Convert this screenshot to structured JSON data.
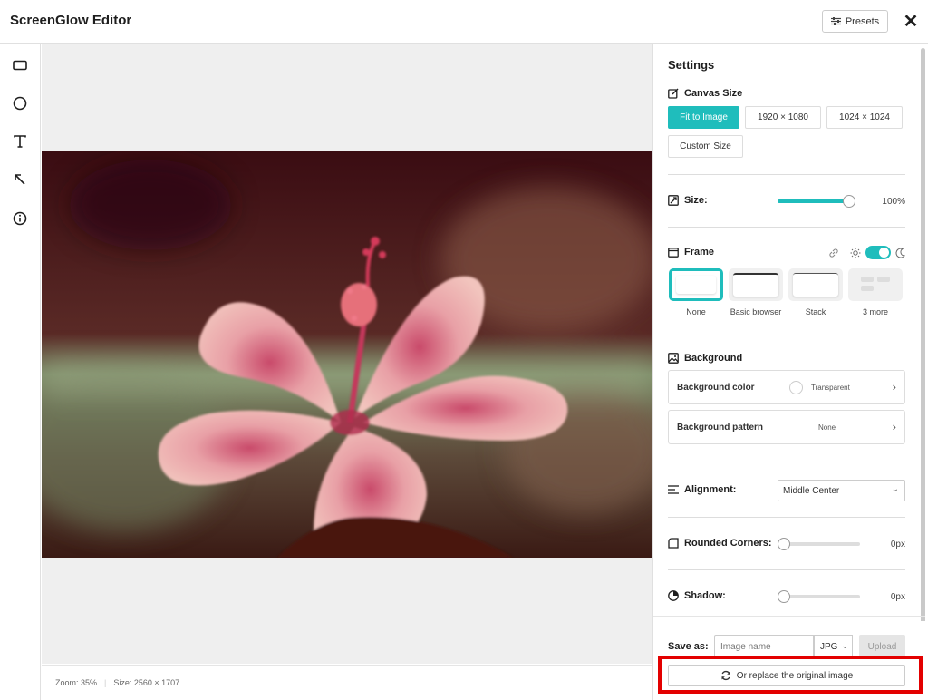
{
  "app": {
    "title": "ScreenGlow Editor",
    "presets_label": "Presets",
    "close_glyph": "✕"
  },
  "toolbar": {
    "tools": [
      "rectangle-icon",
      "circle-icon",
      "text-icon",
      "arrow-icon",
      "info-icon"
    ]
  },
  "status": {
    "zoom": "Zoom: 35%",
    "separator": "|",
    "size": "Size: 2560 × 1707"
  },
  "panel": {
    "title": "Settings",
    "canvas_size": {
      "label": "Canvas Size",
      "options": [
        "Fit to Image",
        "1920 × 1080",
        "1024 × 1024",
        "Custom Size"
      ],
      "selected": "Fit to Image"
    },
    "size": {
      "label": "Size:",
      "value": "100%",
      "level": 1.0
    },
    "frame": {
      "label": "Frame",
      "dark_mode": true,
      "options": [
        "None",
        "Basic browser",
        "Stack",
        "3 more"
      ],
      "selected": "None"
    },
    "background": {
      "label": "Background",
      "color_label": "Background color",
      "color_value": "Transparent",
      "pattern_label": "Background pattern",
      "pattern_value": "None"
    },
    "alignment": {
      "label": "Alignment:",
      "value": "Middle Center"
    },
    "rounded_corners": {
      "label": "Rounded Corners:",
      "value": "0px",
      "level": 0
    },
    "shadow": {
      "label": "Shadow:",
      "value": "0px",
      "level": 0
    },
    "save": {
      "label": "Save as:",
      "name_placeholder": "Image name",
      "format": "JPG",
      "upload_label": "Upload",
      "replace_label": "Or replace the original image"
    }
  },
  "colors": {
    "accent": "#1fbdbc",
    "highlight": "#e30000"
  }
}
